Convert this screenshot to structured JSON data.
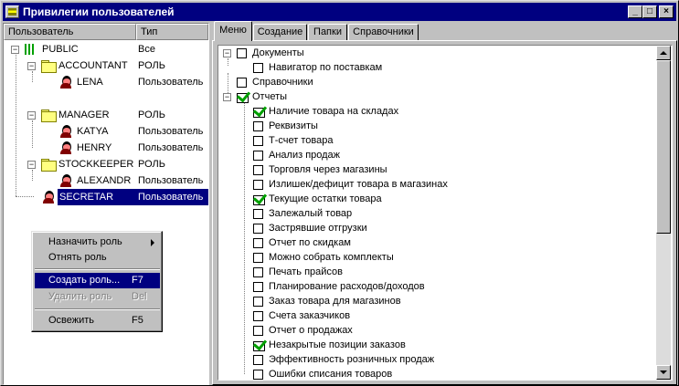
{
  "window": {
    "title": "Привилегии пользователей",
    "minimize": "_",
    "maximize": "□",
    "close": "×"
  },
  "tree": {
    "col_user": "Пользователь",
    "col_type": "Тип",
    "rows": [
      {
        "name": "PUBLIC",
        "type": "Все"
      },
      {
        "name": "ACCOUNTANT",
        "type": "РОЛЬ"
      },
      {
        "name": "LENA",
        "type": "Пользователь"
      },
      {
        "name": "MANAGER",
        "type": "РОЛЬ"
      },
      {
        "name": "KATYA",
        "type": "Пользователь"
      },
      {
        "name": "HENRY",
        "type": "Пользователь"
      },
      {
        "name": "STOCKKEEPER",
        "type": "РОЛЬ"
      },
      {
        "name": "ALEXANDR",
        "type": "Пользователь"
      },
      {
        "name": "SECRETAR",
        "type": "Пользователь"
      }
    ]
  },
  "context_menu": {
    "items": [
      {
        "label": "Назначить роль",
        "shortcut": ""
      },
      {
        "label": "Отнять роль",
        "shortcut": ""
      },
      {
        "label": "Создать роль...",
        "shortcut": "F7"
      },
      {
        "label": "Удалить роль",
        "shortcut": "Del"
      },
      {
        "label": "Освежить",
        "shortcut": "F5"
      }
    ]
  },
  "tabs": [
    "Меню",
    "Создание",
    "Папки",
    "Справочники"
  ],
  "menu_tree": [
    {
      "label": "Документы",
      "checked": false
    },
    {
      "label": "Навигатор по поставкам",
      "checked": false
    },
    {
      "label": "Справочники",
      "checked": false
    },
    {
      "label": "Отчеты",
      "checked": true
    },
    {
      "label": "Наличие товара на складах",
      "checked": true
    },
    {
      "label": "Реквизиты",
      "checked": false
    },
    {
      "label": "Т-счет товара",
      "checked": false
    },
    {
      "label": "Анализ продаж",
      "checked": false
    },
    {
      "label": "Торговля через магазины",
      "checked": false
    },
    {
      "label": "Излишек/дефицит товара в магазинах",
      "checked": false
    },
    {
      "label": "Текущие остатки товара",
      "checked": true
    },
    {
      "label": "Залежалый товар",
      "checked": false
    },
    {
      "label": "Застрявшие отгрузки",
      "checked": false
    },
    {
      "label": "Отчет по скидкам",
      "checked": false
    },
    {
      "label": "Можно собрать комплекты",
      "checked": false
    },
    {
      "label": "Печать прайсов",
      "checked": false
    },
    {
      "label": "Планирование расходов/доходов",
      "checked": false
    },
    {
      "label": "Заказ товара для магазинов",
      "checked": false
    },
    {
      "label": "Счета заказчиков",
      "checked": false
    },
    {
      "label": "Отчет о продажах",
      "checked": false
    },
    {
      "label": "Незакрытые позиции заказов",
      "checked": true
    },
    {
      "label": "Эффективность розничных продаж",
      "checked": false
    },
    {
      "label": "Ошибки списания товаров",
      "checked": false
    }
  ]
}
